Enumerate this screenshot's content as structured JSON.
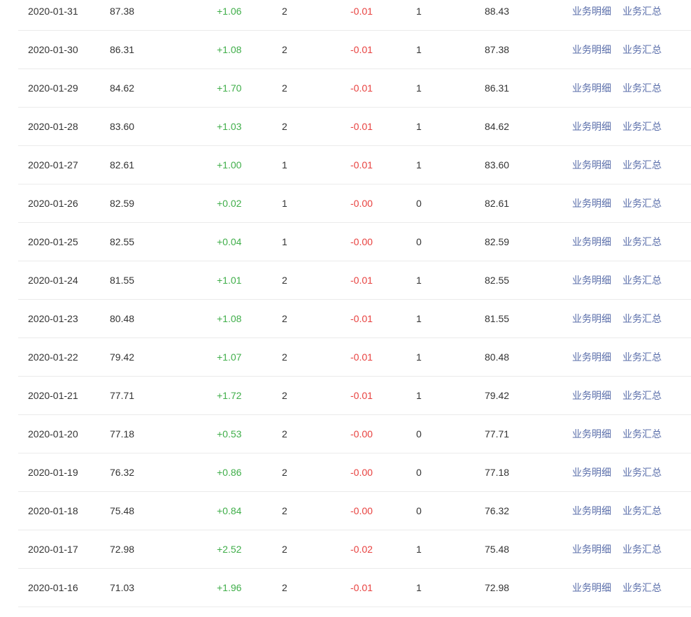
{
  "colors": {
    "increase": "#3fae49",
    "decrease": "#e8413f",
    "link": "#5a6eaa",
    "text": "#333333",
    "divider": "#ebebeb"
  },
  "rows": [
    {
      "date": "2020-01-31",
      "open": "87.38",
      "increase": "+1.06",
      "increase_count": "2",
      "decrease": "-0.01",
      "decrease_count": "1",
      "close": "88.43",
      "detail_link": "业务明细",
      "summary_link": "业务汇总"
    },
    {
      "date": "2020-01-30",
      "open": "86.31",
      "increase": "+1.08",
      "increase_count": "2",
      "decrease": "-0.01",
      "decrease_count": "1",
      "close": "87.38",
      "detail_link": "业务明细",
      "summary_link": "业务汇总"
    },
    {
      "date": "2020-01-29",
      "open": "84.62",
      "increase": "+1.70",
      "increase_count": "2",
      "decrease": "-0.01",
      "decrease_count": "1",
      "close": "86.31",
      "detail_link": "业务明细",
      "summary_link": "业务汇总"
    },
    {
      "date": "2020-01-28",
      "open": "83.60",
      "increase": "+1.03",
      "increase_count": "2",
      "decrease": "-0.01",
      "decrease_count": "1",
      "close": "84.62",
      "detail_link": "业务明细",
      "summary_link": "业务汇总"
    },
    {
      "date": "2020-01-27",
      "open": "82.61",
      "increase": "+1.00",
      "increase_count": "1",
      "decrease": "-0.01",
      "decrease_count": "1",
      "close": "83.60",
      "detail_link": "业务明细",
      "summary_link": "业务汇总"
    },
    {
      "date": "2020-01-26",
      "open": "82.59",
      "increase": "+0.02",
      "increase_count": "1",
      "decrease": "-0.00",
      "decrease_count": "0",
      "close": "82.61",
      "detail_link": "业务明细",
      "summary_link": "业务汇总"
    },
    {
      "date": "2020-01-25",
      "open": "82.55",
      "increase": "+0.04",
      "increase_count": "1",
      "decrease": "-0.00",
      "decrease_count": "0",
      "close": "82.59",
      "detail_link": "业务明细",
      "summary_link": "业务汇总"
    },
    {
      "date": "2020-01-24",
      "open": "81.55",
      "increase": "+1.01",
      "increase_count": "2",
      "decrease": "-0.01",
      "decrease_count": "1",
      "close": "82.55",
      "detail_link": "业务明细",
      "summary_link": "业务汇总"
    },
    {
      "date": "2020-01-23",
      "open": "80.48",
      "increase": "+1.08",
      "increase_count": "2",
      "decrease": "-0.01",
      "decrease_count": "1",
      "close": "81.55",
      "detail_link": "业务明细",
      "summary_link": "业务汇总"
    },
    {
      "date": "2020-01-22",
      "open": "79.42",
      "increase": "+1.07",
      "increase_count": "2",
      "decrease": "-0.01",
      "decrease_count": "1",
      "close": "80.48",
      "detail_link": "业务明细",
      "summary_link": "业务汇总"
    },
    {
      "date": "2020-01-21",
      "open": "77.71",
      "increase": "+1.72",
      "increase_count": "2",
      "decrease": "-0.01",
      "decrease_count": "1",
      "close": "79.42",
      "detail_link": "业务明细",
      "summary_link": "业务汇总"
    },
    {
      "date": "2020-01-20",
      "open": "77.18",
      "increase": "+0.53",
      "increase_count": "2",
      "decrease": "-0.00",
      "decrease_count": "0",
      "close": "77.71",
      "detail_link": "业务明细",
      "summary_link": "业务汇总"
    },
    {
      "date": "2020-01-19",
      "open": "76.32",
      "increase": "+0.86",
      "increase_count": "2",
      "decrease": "-0.00",
      "decrease_count": "0",
      "close": "77.18",
      "detail_link": "业务明细",
      "summary_link": "业务汇总"
    },
    {
      "date": "2020-01-18",
      "open": "75.48",
      "increase": "+0.84",
      "increase_count": "2",
      "decrease": "-0.00",
      "decrease_count": "0",
      "close": "76.32",
      "detail_link": "业务明细",
      "summary_link": "业务汇总"
    },
    {
      "date": "2020-01-17",
      "open": "72.98",
      "increase": "+2.52",
      "increase_count": "2",
      "decrease": "-0.02",
      "decrease_count": "1",
      "close": "75.48",
      "detail_link": "业务明细",
      "summary_link": "业务汇总"
    },
    {
      "date": "2020-01-16",
      "open": "71.03",
      "increase": "+1.96",
      "increase_count": "2",
      "decrease": "-0.01",
      "decrease_count": "1",
      "close": "72.98",
      "detail_link": "业务明细",
      "summary_link": "业务汇总"
    }
  ]
}
